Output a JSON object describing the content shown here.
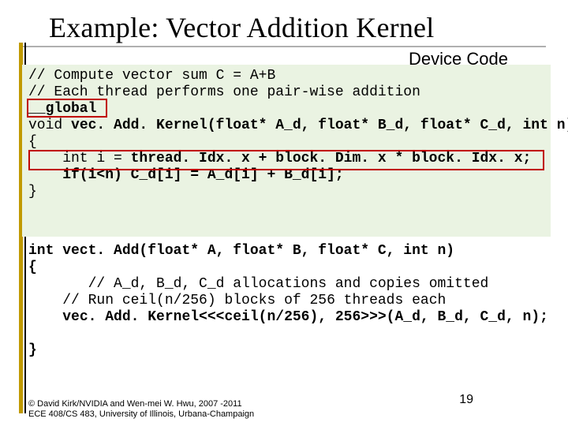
{
  "title": "Example: Vector Addition Kernel",
  "section_label": "Device Code",
  "kernel": {
    "c1": "// Compute vector sum C = A+B",
    "c2": "// Each thread performs one pair-wise addition",
    "global_kw": "__global",
    "sig_pre": "void ",
    "sig_bold": "vec. Add. Kernel(float* A_d, float* B_d, float* C_d, int n)",
    "open": "{",
    "idx_pre": "    int i = ",
    "idx_bold": "thread. Idx. x + block. Dim. x * block. Idx. x;",
    "body_pre": "    ",
    "body_bold": "if(i<n) C_d[i] = A_d[i] + B_d[i];",
    "close": "}"
  },
  "host": {
    "sig": "int vect. Add(float* A, float* B, float* C, int n)",
    "open": "{",
    "c1_pre": "       ",
    "c1": "// A_d, B_d, C_d allocations and copies omitted",
    "c2_pre": "    ",
    "c2": "// Run ceil(n/256) blocks of 256 threads each",
    "call_pre": "    ",
    "call_bold": "vec. Add. Kernel<<<ceil(n/256), 256>>>(A_d, B_d, C_d, n);",
    "close": "}"
  },
  "footer": {
    "l1": "© David Kirk/NVIDIA and Wen-mei W. Hwu, 2007 -2011",
    "l2": "ECE 408/CS 483, University of Illinois, Urbana-Champaign"
  },
  "page_number": "19"
}
